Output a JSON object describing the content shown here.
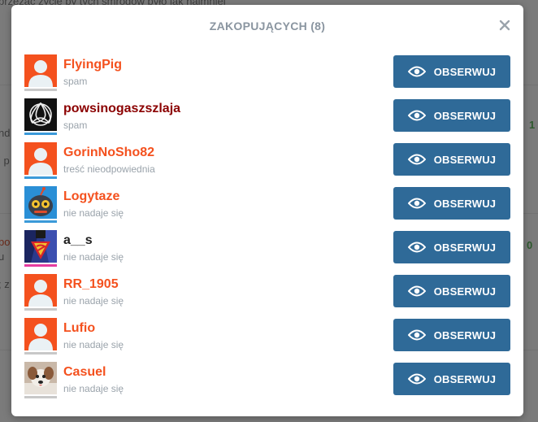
{
  "background": {
    "top_text": "przeżać życie by tych śmrodów było jak najmniej",
    "left_fragments": [
      "nd",
      "i p",
      "bo",
      "u",
      "; z"
    ],
    "right_fragments": [
      "1",
      "0"
    ]
  },
  "modal": {
    "title": "ZAKOPUJĄCYCH (8)",
    "follow_label": "OBSERWUJ",
    "users": [
      {
        "name": "FlyingPig",
        "reason": "spam",
        "name_color": "#f4511e",
        "avatar": "default",
        "bar_color": "#c8c8c8"
      },
      {
        "name": "powsinogaszszlaja",
        "reason": "spam",
        "name_color": "#8b0000",
        "avatar": "knot",
        "bar_color": "#3b9ad9"
      },
      {
        "name": "GorinNoSho82",
        "reason": "treść nieodpowiednia",
        "name_color": "#f4511e",
        "avatar": "default",
        "bar_color": "#3b9ad9"
      },
      {
        "name": "Logytaze",
        "reason": "nie nadaje się",
        "name_color": "#f4511e",
        "avatar": "robot",
        "bar_color": "#3b9ad9"
      },
      {
        "name": "a__s",
        "reason": "nie nadaje się",
        "name_color": "#222222",
        "avatar": "superman",
        "bar_color": "#e63ca0"
      },
      {
        "name": "RR_1905",
        "reason": "nie nadaje się",
        "name_color": "#f4511e",
        "avatar": "default",
        "bar_color": "#c8c8c8"
      },
      {
        "name": "Lufio",
        "reason": "nie nadaje się",
        "name_color": "#f4511e",
        "avatar": "default",
        "bar_color": "#c8c8c8"
      },
      {
        "name": "Casuel",
        "reason": "nie nadaje się",
        "name_color": "#f4511e",
        "avatar": "dog",
        "bar_color": "#c8c8c8"
      }
    ]
  },
  "colors": {
    "accent_button": "#2f6a98",
    "name_orange": "#f4511e",
    "title_gray": "#8a95a0"
  }
}
